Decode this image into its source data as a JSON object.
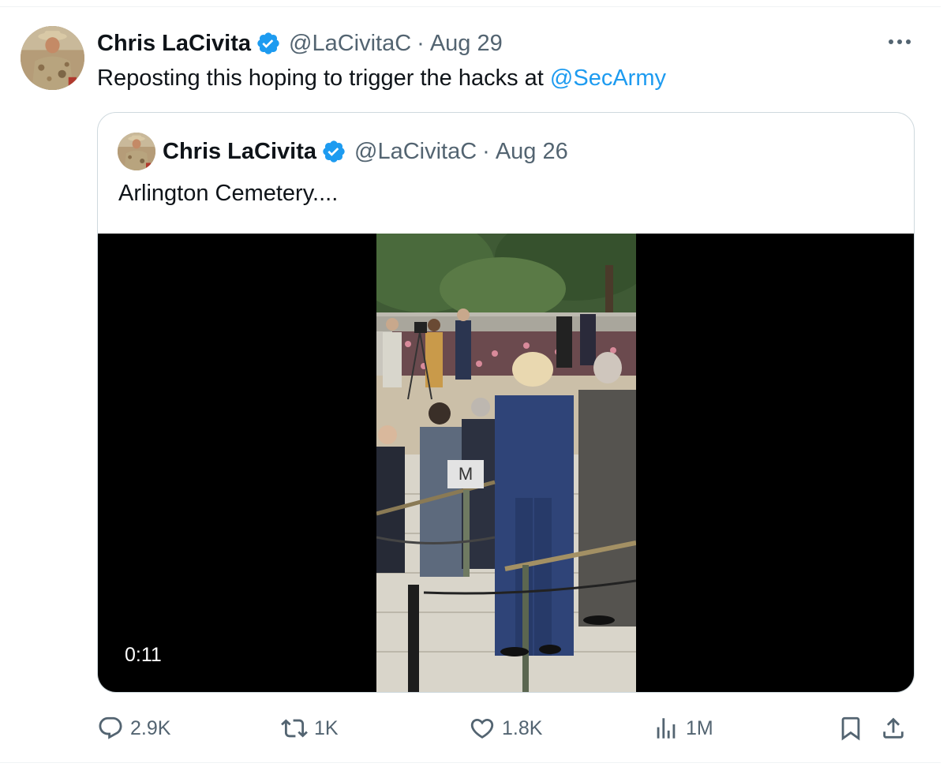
{
  "tweet": {
    "author_name": "Chris LaCivita",
    "handle": "@LaCivitaC",
    "separator": "·",
    "date": "Aug 29",
    "text_prefix": "Reposting this hoping to trigger the hacks at ",
    "mention": "@SecArmy"
  },
  "quoted": {
    "author_name": "Chris LaCivita",
    "handle": "@LaCivitaC",
    "separator": "·",
    "date": "Aug 26",
    "text": "Arlington Cemetery....",
    "video": {
      "duration": "0:11",
      "sign_text": "M"
    }
  },
  "actions": {
    "replies": "2.9K",
    "reposts": "1K",
    "likes": "1.8K",
    "views": "1M"
  },
  "icons": {
    "verified": "verified-badge-icon",
    "more": "more-options-icon",
    "reply": "reply-icon",
    "repost": "repost-icon",
    "like": "heart-icon",
    "views": "views-chart-icon",
    "bookmark": "bookmark-icon",
    "share": "share-icon"
  },
  "colors": {
    "accent": "#1d9bf0",
    "text_primary": "#0f1419",
    "text_muted": "#536471",
    "border": "#cfd9de"
  }
}
